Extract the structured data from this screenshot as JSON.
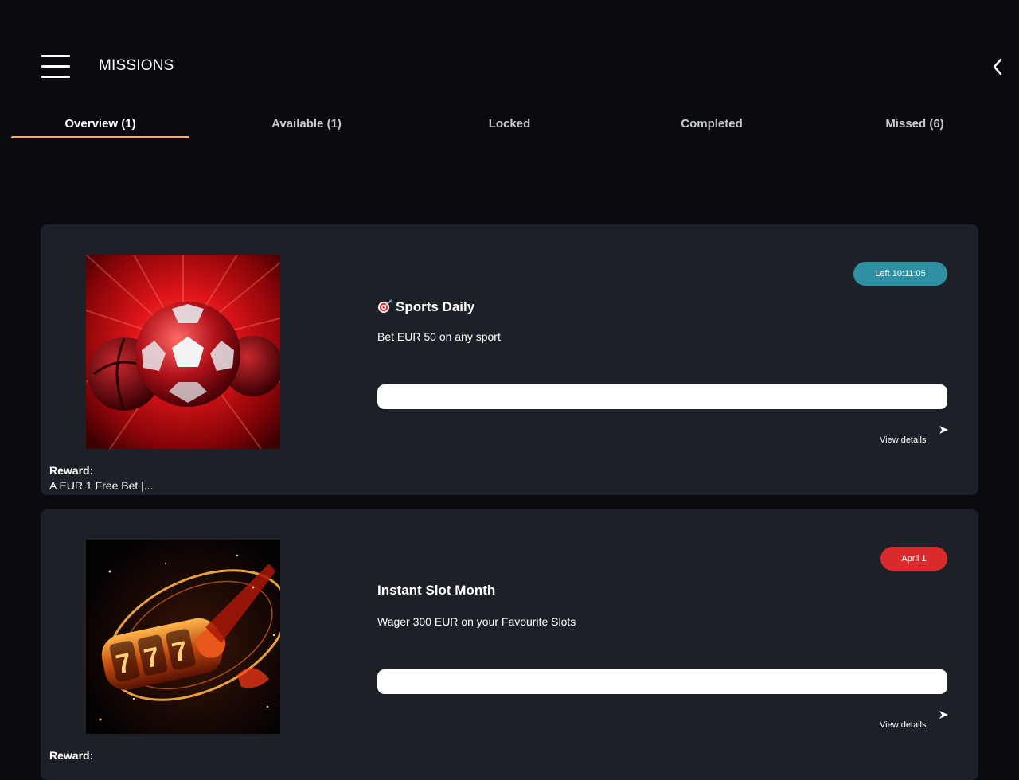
{
  "header": {
    "title": "MISSIONS",
    "menu_icon": "hamburger-menu-icon",
    "back_icon": "chevron-left-icon"
  },
  "tabs": [
    {
      "label": "Overview (1)",
      "active": true
    },
    {
      "label": "Available (1)",
      "active": false
    },
    {
      "label": "Locked",
      "active": false
    },
    {
      "label": "Completed",
      "active": false
    },
    {
      "label": "Missed (6)",
      "active": false
    }
  ],
  "colors": {
    "background": "#090b10",
    "card": "#1e2028",
    "tab_accent": "#f3b63a",
    "timer_badge": "#2f8fa3",
    "date_badge": "#d92b2b"
  },
  "missions": [
    {
      "title": "Sports Daily",
      "title_icon": "target-dart-icon",
      "description": "Bet EUR 50 on any sport",
      "badge": "Left 10:11:05",
      "progress": 0,
      "view_details": "View details",
      "reward_label": "Reward:",
      "reward_value": "A EUR 1 Free Bet |...",
      "image": "sports-balls-image"
    },
    {
      "title": "Instant Slot Month",
      "description": "Wager 300 EUR on your Favourite Slots",
      "badge": "April 1",
      "progress": 0,
      "view_details": "View details",
      "reward_label": "Reward:",
      "image": "slot-reel-777-image"
    }
  ]
}
